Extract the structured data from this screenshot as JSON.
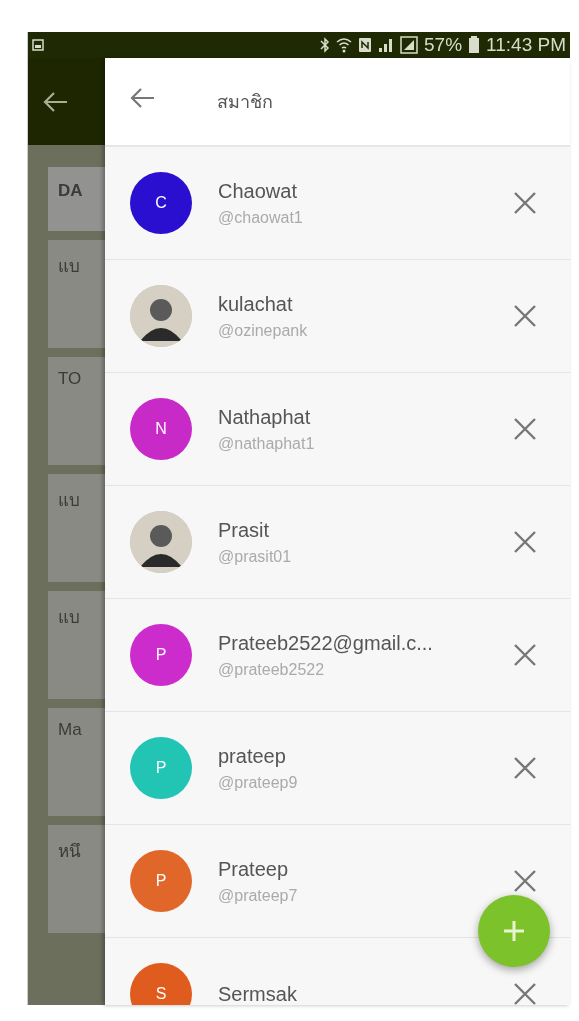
{
  "status_bar": {
    "battery": "57%",
    "time": "11:43 PM"
  },
  "background_app": {
    "cards": [
      {
        "label": "DA",
        "kind": "header"
      },
      {
        "label": "แบ",
        "kind": "item"
      },
      {
        "label": "TO",
        "kind": "item"
      },
      {
        "label": "แบ",
        "kind": "item"
      },
      {
        "label": "แบ",
        "kind": "item"
      },
      {
        "label": "Ma",
        "kind": "item"
      },
      {
        "label": "หนึ",
        "kind": "item"
      }
    ]
  },
  "drawer": {
    "title": "สมาชิก",
    "members": [
      {
        "name": "Chaowat",
        "handle": "@chaowat1",
        "kind": "initial",
        "initial": "C",
        "color": "#2a0fd0"
      },
      {
        "name": "kulachat",
        "handle": "@ozinepank",
        "kind": "photo"
      },
      {
        "name": "Nathaphat",
        "handle": "@nathaphat1",
        "kind": "initial",
        "initial": "N",
        "color": "#c82ac8"
      },
      {
        "name": "Prasit",
        "handle": "@prasit01",
        "kind": "photo"
      },
      {
        "name": "Prateeb2522@gmail.c...",
        "handle": "@prateeb2522",
        "kind": "initial",
        "initial": "P",
        "color": "#cc2ccc"
      },
      {
        "name": "prateep",
        "handle": "@prateep9",
        "kind": "initial",
        "initial": "P",
        "color": "#22c4b4"
      },
      {
        "name": "Prateep",
        "handle": "@prateep7",
        "kind": "initial",
        "initial": "P",
        "color": "#e0662a"
      },
      {
        "name": "Sermsak",
        "kind": "initial",
        "initial": "S",
        "color": "#e05c1e"
      }
    ]
  }
}
